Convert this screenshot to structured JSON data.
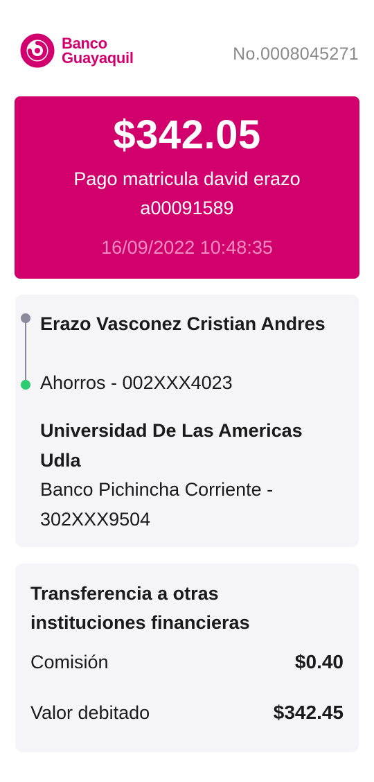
{
  "header": {
    "brand_line1": "Banco",
    "brand_line2": "Guayaquil",
    "receipt_number": "No.0008045271"
  },
  "transaction": {
    "amount": "$342.05",
    "description": "Pago matricula david erazo a00091589",
    "datetime": "16/09/2022 10:48:35"
  },
  "origin": {
    "name": "Erazo Vasconez Cristian Andres",
    "account": "Ahorros - 002XXX4023"
  },
  "destination": {
    "name": "Universidad De Las Americas Udla",
    "account": "Banco Pichincha Corriente - 302XXX9504"
  },
  "summary": {
    "type": "Transferencia a otras instituciones financieras",
    "fee_label": "Comisión",
    "fee_value": "$0.40",
    "debited_label": "Valor debitado",
    "debited_value": "$342.45"
  },
  "colors": {
    "brand": "#d2006e",
    "card": "#d1006c",
    "date_text": "#f08cbf",
    "panel": "#f5f5f7",
    "dot_origin": "#8a8a9a",
    "dot_destination": "#2ecc71"
  },
  "icons": {
    "logo": "banco-guayaquil-logo-icon"
  }
}
